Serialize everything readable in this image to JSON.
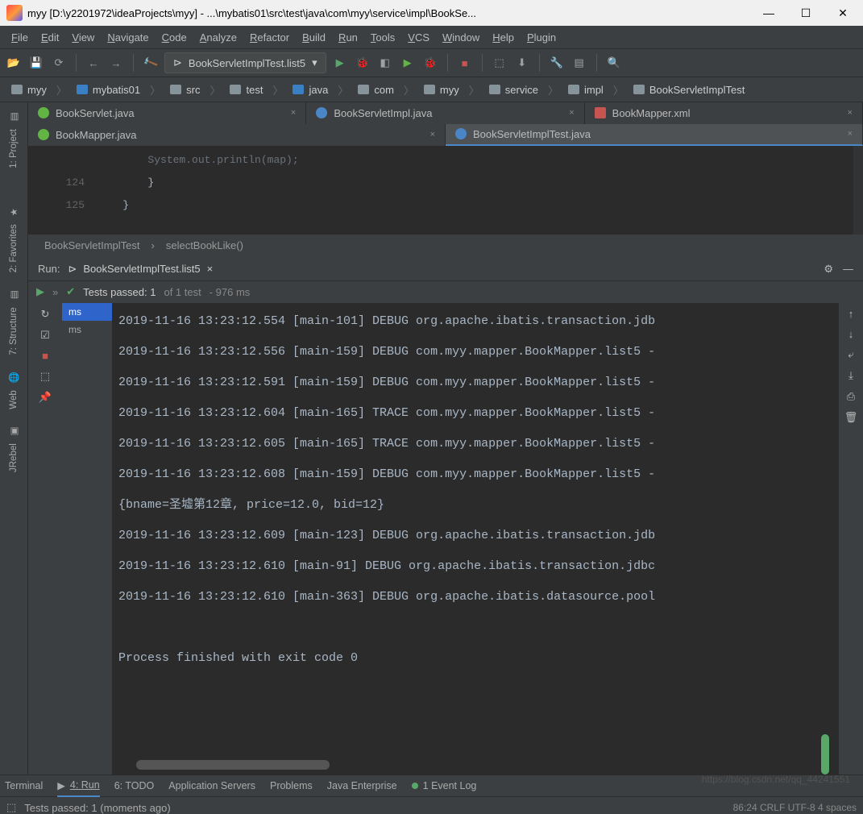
{
  "titlebar": {
    "text": "myy [D:\\y2201972\\ideaProjects\\myy] - ...\\mybatis01\\src\\test\\java\\com\\myy\\service\\impl\\BookSe..."
  },
  "menu": [
    "File",
    "Edit",
    "View",
    "Navigate",
    "Code",
    "Analyze",
    "Refactor",
    "Build",
    "Run",
    "Tools",
    "VCS",
    "Window",
    "Help",
    "Plugin"
  ],
  "run_config": "BookServletImplTest.list5",
  "breadcrumbs": [
    "myy",
    "mybatis01",
    "src",
    "test",
    "java",
    "com",
    "myy",
    "service",
    "impl",
    "BookServletImplTest"
  ],
  "tabs_row1": [
    {
      "label": "BookServlet.java",
      "icon": "green",
      "close": "×"
    },
    {
      "label": "BookServletImpl.java",
      "icon": "blue",
      "close": "×"
    },
    {
      "label": "BookMapper.xml",
      "icon": "xml",
      "close": "×"
    }
  ],
  "tabs_row2": [
    {
      "label": "BookMapper.java",
      "icon": "green",
      "close": "×"
    },
    {
      "label": "BookServletImplTest.java",
      "icon": "blue",
      "active": true,
      "close": "×"
    }
  ],
  "gutter": [
    "124",
    "125"
  ],
  "code_fragment": {
    "line_part": "System.out.println(map);",
    "brace1": "}",
    "brace2": "}"
  },
  "editor_breadcrumb": [
    "BookServletImplTest",
    "selectBookLike()"
  ],
  "run": {
    "label": "Run:",
    "tab": "BookServletImplTest.list5",
    "tab_close": "×",
    "pass_text_1": "Tests passed: 1",
    "pass_text_2": " of 1 test",
    "pass_time": " - 976 ms",
    "stack_items": [
      "ms",
      "ms"
    ]
  },
  "console_lines": [
    "2019-11-16 13:23:12.554 [main-101] DEBUG org.apache.ibatis.transaction.jdb",
    "2019-11-16 13:23:12.556 [main-159] DEBUG com.myy.mapper.BookMapper.list5 -",
    "2019-11-16 13:23:12.591 [main-159] DEBUG com.myy.mapper.BookMapper.list5 -",
    "2019-11-16 13:23:12.604 [main-165] TRACE com.myy.mapper.BookMapper.list5 -",
    "2019-11-16 13:23:12.605 [main-165] TRACE com.myy.mapper.BookMapper.list5 -",
    "2019-11-16 13:23:12.608 [main-159] DEBUG com.myy.mapper.BookMapper.list5 -",
    "{bname=圣墟第12章, price=12.0, bid=12}",
    "2019-11-16 13:23:12.609 [main-123] DEBUG org.apache.ibatis.transaction.jdb",
    "2019-11-16 13:23:12.610 [main-91] DEBUG org.apache.ibatis.transaction.jdbc",
    "2019-11-16 13:23:12.610 [main-363] DEBUG org.apache.ibatis.datasource.pool",
    "",
    "Process finished with exit code 0"
  ],
  "bottom_tabs": [
    {
      "label": "Terminal"
    },
    {
      "label": "4: Run",
      "active": true,
      "prefix": "▶"
    },
    {
      "label": "6: TODO"
    },
    {
      "label": "Application Servers"
    },
    {
      "label": "Problems"
    },
    {
      "label": "Java Enterprise"
    },
    {
      "label": "Event Log",
      "badge": "1"
    }
  ],
  "status": {
    "left_text": "Tests passed: 1 (moments ago)",
    "right_text": "86:24  CRLF  UTF-8  4 spaces"
  },
  "watermark": "https://blog.csdn.net/qq_44241551"
}
